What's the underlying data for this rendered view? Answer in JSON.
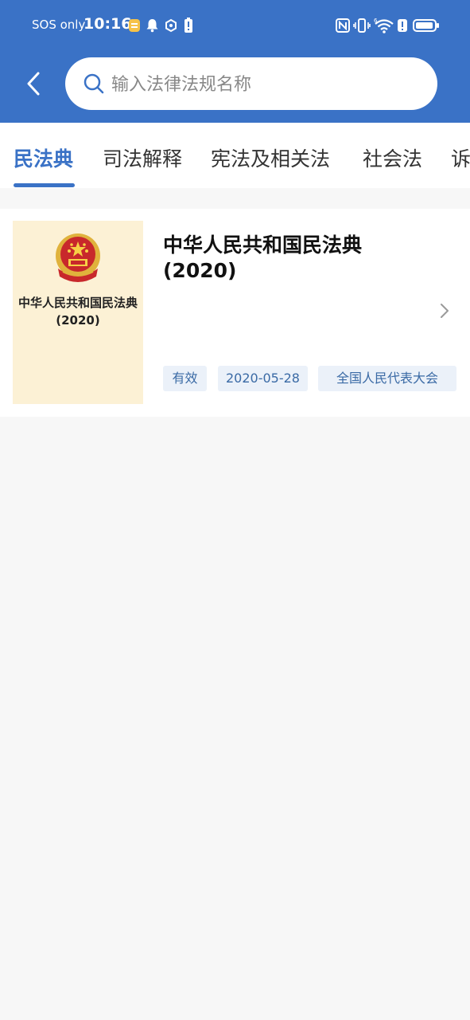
{
  "status_bar": {
    "carrier": "SOS only",
    "time": "10:16",
    "icons_left": [
      "notes-app-icon",
      "bell-icon",
      "sync-icon",
      "battery-alert-icon"
    ],
    "icons_right": [
      "nfc-icon",
      "vibrate-icon",
      "wifi-icon",
      "alert-icon",
      "battery-icon"
    ]
  },
  "header": {
    "back_icon": "chevron-left-icon",
    "search": {
      "placeholder": "输入法律法规名称",
      "value": ""
    }
  },
  "tabs": [
    {
      "label": "民法典",
      "active": true
    },
    {
      "label": "司法解释",
      "active": false
    },
    {
      "label": "宪法及相关法",
      "active": false
    },
    {
      "label": "社会法",
      "active": false
    },
    {
      "label": "诉",
      "active": false
    }
  ],
  "law_list": [
    {
      "cover_text": "中华人民共和国民法典 (2020)",
      "title": "中华人民共和国民法典 (2020)",
      "tags": [
        "有效",
        "2020-05-28",
        "全国人民代表大会"
      ]
    }
  ],
  "colors": {
    "primary": "#3a72c6",
    "background": "#f7f7f7",
    "cover_background": "#fcf1d5",
    "tag_background": "#ebf1f9",
    "tag_text": "#3a6aa5"
  }
}
